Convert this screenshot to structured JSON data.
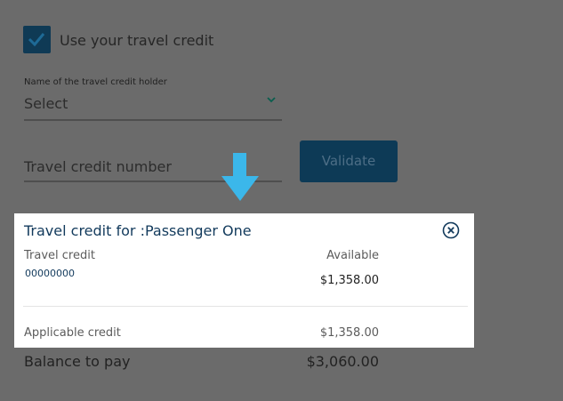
{
  "credit_checkbox": {
    "label": "Use your travel credit",
    "checked": true
  },
  "holder_field": {
    "label": "Name of the travel credit holder",
    "value": "Select",
    "icon": "chevron-down-icon"
  },
  "number_field": {
    "placeholder": "Travel credit number"
  },
  "validate_button": {
    "label": "Validate"
  },
  "pointer_arrow": {
    "icon": "down-arrow-icon",
    "color": "#3bb7ea"
  },
  "credit_card": {
    "title": "Travel credit for :Passenger One",
    "close_icon": "close-circle-icon",
    "travel_credit_label": "Travel credit",
    "available_label": "Available",
    "credit_code": "00000000",
    "available_amount": "$1,358.00",
    "applicable_label": "Applicable credit",
    "applicable_amount": "$1,358.00"
  },
  "balance": {
    "label": "Balance to pay",
    "amount": "$3,060.00"
  },
  "colors": {
    "overlay": "#6b6b6b",
    "brand_dark": "#0d3a56",
    "title": "#123a5c"
  }
}
